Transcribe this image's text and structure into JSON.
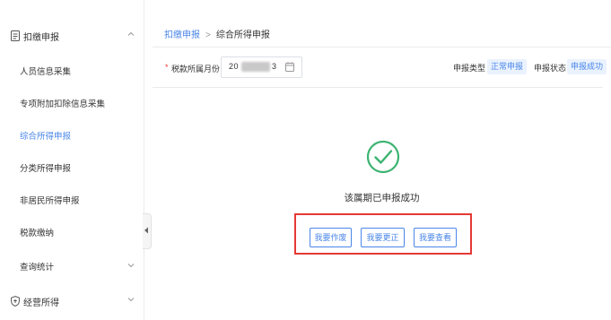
{
  "sidebar": {
    "group1_label": "扣缴申报",
    "items": [
      {
        "label": "人员信息采集"
      },
      {
        "label": "专项附加扣除信息采集"
      },
      {
        "label": "综合所得申报"
      },
      {
        "label": "分类所得申报"
      },
      {
        "label": "非居民所得申报"
      },
      {
        "label": "税款缴纳"
      },
      {
        "label": "查询统计"
      }
    ],
    "group2_label": "经营所得"
  },
  "breadcrumb": {
    "parent": "扣缴申报",
    "separator": ">",
    "current": "综合所得申报"
  },
  "filter": {
    "required_mark": "*",
    "period_label": "税款所属月份",
    "period_value_prefix": "20",
    "period_value_suffix": "3",
    "declare_type_label": "申报类型",
    "declare_type_value": "正常申报",
    "declare_status_label": "申报状态",
    "declare_status_value": "申报成功"
  },
  "result": {
    "message": "该属期已申报成功"
  },
  "actions": {
    "void_label": "我要作废",
    "correct_label": "我要更正",
    "view_label": "我要查看"
  },
  "colors": {
    "accent": "#4a86e8",
    "success": "#3cb371",
    "highlight_box": "#e53935"
  },
  "icons": {
    "group1": "document-icon",
    "group2": "shield-icon",
    "calendar": "calendar-icon",
    "success": "check-circle-icon"
  }
}
